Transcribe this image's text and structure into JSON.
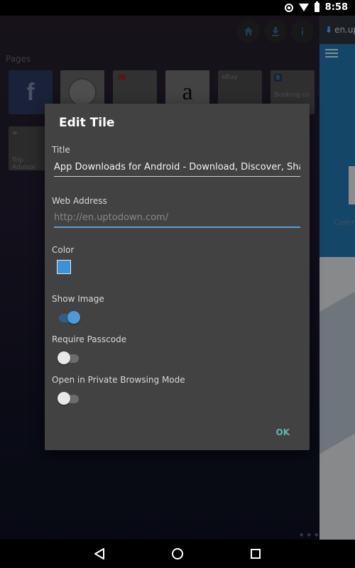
{
  "status_bar": {
    "time": "8:58",
    "icons": [
      "data-saver-icon",
      "wifi-icon",
      "battery-icon"
    ]
  },
  "background": {
    "pages_label": "Pages",
    "tiles": [
      {
        "name": "facebook",
        "label": "f"
      },
      {
        "name": "wikipedia",
        "label": ""
      },
      {
        "name": "youtube",
        "label": ""
      },
      {
        "name": "amazon",
        "label": "a"
      },
      {
        "name": "ebay",
        "label": "eBay"
      },
      {
        "name": "booking",
        "label": "Booking.co"
      },
      {
        "name": "tripadvisor",
        "label": "Trip Advisor"
      }
    ],
    "toolbar_icons": [
      "home-icon",
      "download-icon",
      "info-icon"
    ]
  },
  "right_panel": {
    "url": "en.up",
    "partial_text": "Comm"
  },
  "dialog": {
    "title": "Edit Tile",
    "title_label": "Title",
    "title_value": "App Downloads for Android - Download, Discover, Share on Uptodown",
    "web_address_label": "Web Address",
    "web_address_placeholder": "http://en.uptodown.com/",
    "color_label": "Color",
    "color_value": "#3c92d2",
    "show_image_label": "Show Image",
    "show_image": true,
    "require_passcode_label": "Require Passcode",
    "require_passcode": false,
    "private_mode_label": "Open in Private Browsing Mode",
    "private_mode": false,
    "ok_label": "OK"
  },
  "nav_bar": {
    "icons": [
      "back-icon",
      "home-icon",
      "recents-icon"
    ]
  }
}
